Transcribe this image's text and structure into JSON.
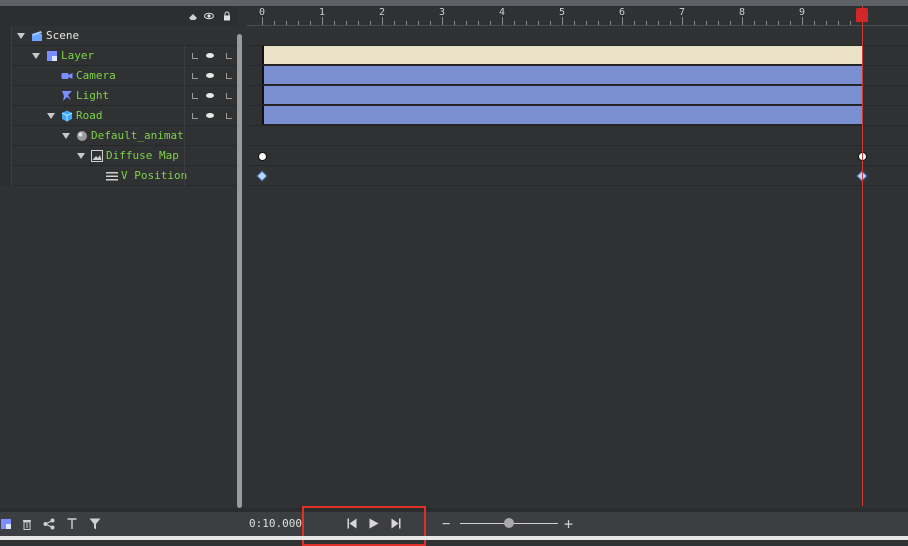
{
  "tree": {
    "header_icons": [
      "lock-toggle-all-icon",
      "eye-toggle-all-icon",
      "padlock-all-icon"
    ],
    "rows": [
      {
        "label": "Scene",
        "icon": "scene-clapper-icon",
        "color": "#e6e6e6"
      },
      {
        "label": "Layer",
        "icon": "layer-icon",
        "color": "#7fd24a"
      },
      {
        "label": "Camera",
        "icon": "camera-icon",
        "color": "#7fd24a"
      },
      {
        "label": "Light",
        "icon": "light-icon",
        "color": "#7fd24a"
      },
      {
        "label": "Road",
        "icon": "cube-icon",
        "color": "#7fd24a"
      },
      {
        "label": "Default_animata",
        "icon": "material-sphere-icon",
        "color": "#7fd24a"
      },
      {
        "label": "Diffuse Map",
        "icon": "image-map-icon",
        "color": "#7fd24a"
      },
      {
        "label": "V Position",
        "icon": "property-lines-icon",
        "color": "#7fd24a"
      }
    ]
  },
  "ruler": {
    "labels": [
      "0",
      "1",
      "2",
      "3",
      "4",
      "5",
      "6",
      "7",
      "8",
      "9"
    ]
  },
  "timeline": {
    "current_time": 10,
    "bars": [
      {
        "row": "Layer",
        "start": 0,
        "end": 10,
        "color": "#e9e2c7"
      },
      {
        "row": "Camera",
        "start": 0,
        "end": 10,
        "color": "#7a8fcf"
      },
      {
        "row": "Light",
        "start": 0,
        "end": 10,
        "color": "#7a8fcf"
      },
      {
        "row": "Road",
        "start": 0,
        "end": 10,
        "color": "#7a8fcf"
      }
    ],
    "keyframes": [
      {
        "row": "Diffuse Map",
        "shape": "circle",
        "times": [
          0,
          10
        ]
      },
      {
        "row": "V Position",
        "shape": "diamond",
        "times": [
          0,
          10
        ]
      }
    ],
    "playhead_color": "#d23a3a"
  },
  "bottombar": {
    "left_icons": [
      "add-layer-icon",
      "delete-icon",
      "share-icon",
      "text-icon",
      "filter-icon"
    ],
    "time_readout": "0:10.000",
    "transport": [
      "go-to-start-icon",
      "play-icon",
      "go-to-end-icon"
    ],
    "zoom": {
      "minus": "−",
      "plus": "+",
      "level": 0.5
    }
  },
  "colors": {
    "accent_green": "#7fd24a",
    "bar_blue": "#7a8fcf",
    "bar_cream": "#e9e2c7",
    "highlight_red": "#e0302a"
  }
}
